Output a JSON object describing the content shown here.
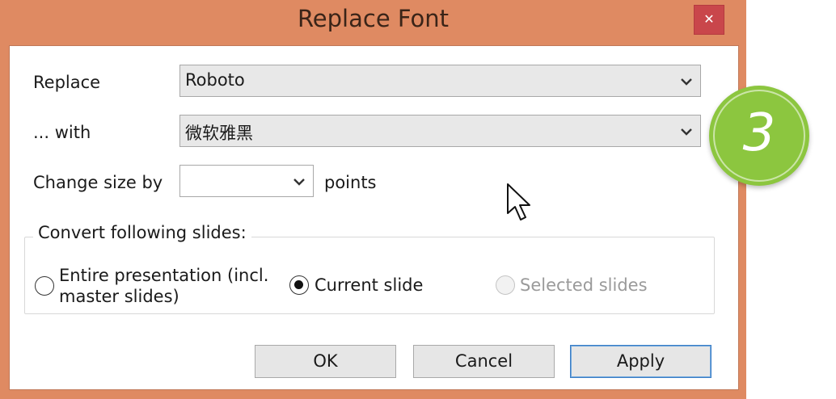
{
  "dialog": {
    "title": "Replace Font",
    "close_glyph": "✕"
  },
  "replace": {
    "label": "Replace",
    "value": "Roboto"
  },
  "with": {
    "label": "... with",
    "value": "微软雅黑"
  },
  "size": {
    "label": "Change size by",
    "value": "",
    "units": "points"
  },
  "convert": {
    "legend": "Convert following slides:",
    "options": [
      {
        "label_line1": "Entire presentation (incl.",
        "label_line2": "master slides)",
        "checked": false,
        "enabled": true
      },
      {
        "label": "Current slide",
        "checked": true,
        "enabled": true
      },
      {
        "label": "Selected slides",
        "checked": false,
        "enabled": false
      }
    ]
  },
  "buttons": {
    "ok": "OK",
    "cancel": "Cancel",
    "apply": "Apply"
  },
  "step_badge": {
    "number": "3",
    "color": "#8cc63f"
  },
  "icons": {
    "close": "close-icon",
    "dropdown": "chevron-down-icon",
    "pointer": "mouse-pointer-icon"
  },
  "colors": {
    "window_frame": "#df8a62",
    "close_button": "#c9464b",
    "default_button_border": "#3c7fc6"
  }
}
